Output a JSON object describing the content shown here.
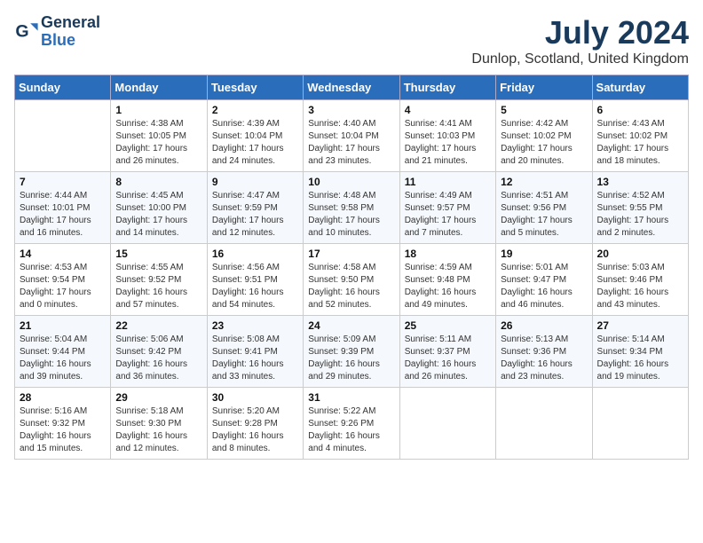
{
  "header": {
    "logo_line1": "General",
    "logo_line2": "Blue",
    "month_title": "July 2024",
    "location": "Dunlop, Scotland, United Kingdom"
  },
  "days_of_week": [
    "Sunday",
    "Monday",
    "Tuesday",
    "Wednesday",
    "Thursday",
    "Friday",
    "Saturday"
  ],
  "weeks": [
    [
      {
        "num": "",
        "info": ""
      },
      {
        "num": "1",
        "info": "Sunrise: 4:38 AM\nSunset: 10:05 PM\nDaylight: 17 hours\nand 26 minutes."
      },
      {
        "num": "2",
        "info": "Sunrise: 4:39 AM\nSunset: 10:04 PM\nDaylight: 17 hours\nand 24 minutes."
      },
      {
        "num": "3",
        "info": "Sunrise: 4:40 AM\nSunset: 10:04 PM\nDaylight: 17 hours\nand 23 minutes."
      },
      {
        "num": "4",
        "info": "Sunrise: 4:41 AM\nSunset: 10:03 PM\nDaylight: 17 hours\nand 21 minutes."
      },
      {
        "num": "5",
        "info": "Sunrise: 4:42 AM\nSunset: 10:02 PM\nDaylight: 17 hours\nand 20 minutes."
      },
      {
        "num": "6",
        "info": "Sunrise: 4:43 AM\nSunset: 10:02 PM\nDaylight: 17 hours\nand 18 minutes."
      }
    ],
    [
      {
        "num": "7",
        "info": "Sunrise: 4:44 AM\nSunset: 10:01 PM\nDaylight: 17 hours\nand 16 minutes."
      },
      {
        "num": "8",
        "info": "Sunrise: 4:45 AM\nSunset: 10:00 PM\nDaylight: 17 hours\nand 14 minutes."
      },
      {
        "num": "9",
        "info": "Sunrise: 4:47 AM\nSunset: 9:59 PM\nDaylight: 17 hours\nand 12 minutes."
      },
      {
        "num": "10",
        "info": "Sunrise: 4:48 AM\nSunset: 9:58 PM\nDaylight: 17 hours\nand 10 minutes."
      },
      {
        "num": "11",
        "info": "Sunrise: 4:49 AM\nSunset: 9:57 PM\nDaylight: 17 hours\nand 7 minutes."
      },
      {
        "num": "12",
        "info": "Sunrise: 4:51 AM\nSunset: 9:56 PM\nDaylight: 17 hours\nand 5 minutes."
      },
      {
        "num": "13",
        "info": "Sunrise: 4:52 AM\nSunset: 9:55 PM\nDaylight: 17 hours\nand 2 minutes."
      }
    ],
    [
      {
        "num": "14",
        "info": "Sunrise: 4:53 AM\nSunset: 9:54 PM\nDaylight: 17 hours\nand 0 minutes."
      },
      {
        "num": "15",
        "info": "Sunrise: 4:55 AM\nSunset: 9:52 PM\nDaylight: 16 hours\nand 57 minutes."
      },
      {
        "num": "16",
        "info": "Sunrise: 4:56 AM\nSunset: 9:51 PM\nDaylight: 16 hours\nand 54 minutes."
      },
      {
        "num": "17",
        "info": "Sunrise: 4:58 AM\nSunset: 9:50 PM\nDaylight: 16 hours\nand 52 minutes."
      },
      {
        "num": "18",
        "info": "Sunrise: 4:59 AM\nSunset: 9:48 PM\nDaylight: 16 hours\nand 49 minutes."
      },
      {
        "num": "19",
        "info": "Sunrise: 5:01 AM\nSunset: 9:47 PM\nDaylight: 16 hours\nand 46 minutes."
      },
      {
        "num": "20",
        "info": "Sunrise: 5:03 AM\nSunset: 9:46 PM\nDaylight: 16 hours\nand 43 minutes."
      }
    ],
    [
      {
        "num": "21",
        "info": "Sunrise: 5:04 AM\nSunset: 9:44 PM\nDaylight: 16 hours\nand 39 minutes."
      },
      {
        "num": "22",
        "info": "Sunrise: 5:06 AM\nSunset: 9:42 PM\nDaylight: 16 hours\nand 36 minutes."
      },
      {
        "num": "23",
        "info": "Sunrise: 5:08 AM\nSunset: 9:41 PM\nDaylight: 16 hours\nand 33 minutes."
      },
      {
        "num": "24",
        "info": "Sunrise: 5:09 AM\nSunset: 9:39 PM\nDaylight: 16 hours\nand 29 minutes."
      },
      {
        "num": "25",
        "info": "Sunrise: 5:11 AM\nSunset: 9:37 PM\nDaylight: 16 hours\nand 26 minutes."
      },
      {
        "num": "26",
        "info": "Sunrise: 5:13 AM\nSunset: 9:36 PM\nDaylight: 16 hours\nand 23 minutes."
      },
      {
        "num": "27",
        "info": "Sunrise: 5:14 AM\nSunset: 9:34 PM\nDaylight: 16 hours\nand 19 minutes."
      }
    ],
    [
      {
        "num": "28",
        "info": "Sunrise: 5:16 AM\nSunset: 9:32 PM\nDaylight: 16 hours\nand 15 minutes."
      },
      {
        "num": "29",
        "info": "Sunrise: 5:18 AM\nSunset: 9:30 PM\nDaylight: 16 hours\nand 12 minutes."
      },
      {
        "num": "30",
        "info": "Sunrise: 5:20 AM\nSunset: 9:28 PM\nDaylight: 16 hours\nand 8 minutes."
      },
      {
        "num": "31",
        "info": "Sunrise: 5:22 AM\nSunset: 9:26 PM\nDaylight: 16 hours\nand 4 minutes."
      },
      {
        "num": "",
        "info": ""
      },
      {
        "num": "",
        "info": ""
      },
      {
        "num": "",
        "info": ""
      }
    ]
  ]
}
